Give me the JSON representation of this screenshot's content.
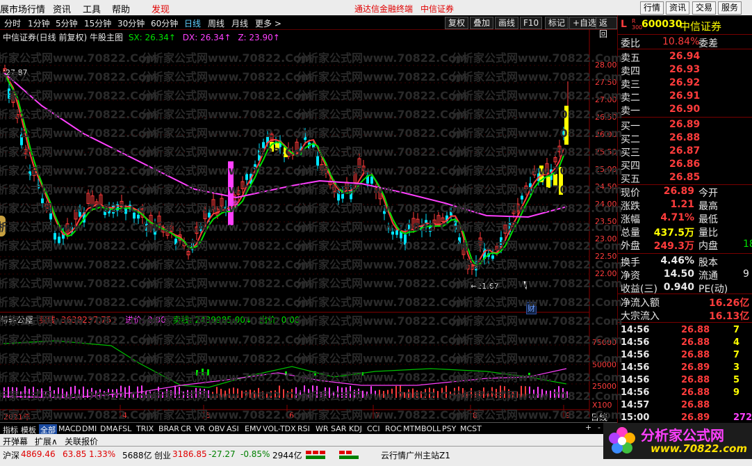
{
  "menubar": {
    "items": [
      "展市场行情",
      "资讯",
      "工具",
      "帮助",
      "发现"
    ],
    "center_links": [
      "通达信金融终端",
      "中信证券"
    ],
    "right_buttons": [
      "行情",
      "资讯",
      "交易",
      "服务"
    ]
  },
  "period_toolbar": {
    "periods": [
      "分时",
      "1分钟",
      "5分钟",
      "15分钟",
      "30分钟",
      "60分钟",
      "日线",
      "周线",
      "月线",
      "更多 >"
    ],
    "active": "日线",
    "tools": [
      "复权",
      "叠加",
      "画线",
      "F10",
      "标记",
      "+自选",
      "返回"
    ]
  },
  "chart_header": {
    "title": "中信证券(日线 前复权) 牛股主图",
    "sx": "SX: 26.34↑",
    "dx": "DX: 26.34↑",
    "z": "Z: 23.90↑"
  },
  "price_axis": [
    "28.00",
    "27.50",
    "27.00",
    "26.50",
    "26.00",
    "25.50",
    "25.00",
    "24.50",
    "24.00",
    "23.50",
    "23.00",
    "22.50",
    "22.00"
  ],
  "annotations": {
    "high": "27.87",
    "low": "←21.67",
    "ting": "停",
    "cai": "财"
  },
  "sub_header": {
    "name": "与转公屋",
    "buy_label": "买线: 3638237.75↑",
    "in_label": "进价: 0.00",
    "sell_label": "卖线: 2439985.00↓",
    "out_label": "出价: 0.00"
  },
  "sub_axis": [
    "75000",
    "50000",
    "25000",
    "X100"
  ],
  "x_axis": [
    "2021年",
    "4",
    "5",
    "6",
    "7",
    "8",
    "9"
  ],
  "x_axis_right": "日线",
  "indicator_tabs": [
    "指标",
    "模板",
    "全部",
    "MACD",
    "DMI",
    "DMA",
    "FSL",
    "TRIX",
    "BRAR",
    "CR",
    "VR",
    "OBV",
    "ASI",
    "EMV",
    "VOL-TDX",
    "RSI",
    "WR",
    "SAR",
    "KDJ",
    "CCI",
    "ROC",
    "MTM",
    "BOLL",
    "PSY",
    "MCST"
  ],
  "active_tab": "全部",
  "bottom_links": [
    "开弹幕",
    "扩展∧",
    "关联报价"
  ],
  "quote": {
    "badge_l": "L",
    "badge_r": "R 300",
    "code": "600030",
    "name": "中信证券",
    "weibi_label": "委比",
    "weibi": "10.84%",
    "weicha_label": "委差",
    "asks": [
      {
        "label": "卖五",
        "price": "26.94"
      },
      {
        "label": "卖四",
        "price": "26.93"
      },
      {
        "label": "卖三",
        "price": "26.92"
      },
      {
        "label": "卖二",
        "price": "26.91"
      },
      {
        "label": "卖一",
        "price": "26.90"
      }
    ],
    "bids": [
      {
        "label": "买一",
        "price": "26.89"
      },
      {
        "label": "买二",
        "price": "26.88"
      },
      {
        "label": "买三",
        "price": "26.87"
      },
      {
        "label": "买四",
        "price": "26.86"
      },
      {
        "label": "买五",
        "price": "26.85"
      }
    ],
    "stats": [
      {
        "label": "现价",
        "value": "26.89",
        "label2": "今开"
      },
      {
        "label": "涨跌",
        "value": "1.21",
        "label2": "最高"
      },
      {
        "label": "涨幅",
        "value": "4.71%",
        "label2": "最低"
      },
      {
        "label": "总量",
        "value": "437.5万",
        "label2": "量比"
      },
      {
        "label": "外盘",
        "value": "249.3万",
        "label2": "内盘",
        "extra": "18"
      }
    ],
    "stats2": [
      {
        "label": "换手",
        "value": "4.46%",
        "label2": "股本"
      },
      {
        "label": "净资",
        "value": "14.50",
        "label2": "流通",
        "extra": "9"
      },
      {
        "label": "收益(三)",
        "value": "0.940",
        "label2": "PE(动)"
      }
    ],
    "flows": [
      {
        "label": "净流入额",
        "value": "16.26亿"
      },
      {
        "label": "大宗流入",
        "value": "16.13亿"
      }
    ],
    "ticks": [
      {
        "time": "14:56",
        "price": "26.88",
        "vol": "7"
      },
      {
        "time": "14:56",
        "price": "26.88",
        "vol": "4"
      },
      {
        "time": "14:56",
        "price": "26.88",
        "vol": "7"
      },
      {
        "time": "14:56",
        "price": "26.89",
        "vol": "3"
      },
      {
        "time": "14:56",
        "price": "26.88",
        "vol": "5"
      },
      {
        "time": "14:56",
        "price": "26.88",
        "vol": "9"
      },
      {
        "time": "14:57",
        "price": "26.88",
        "vol": ""
      },
      {
        "time": "15:00",
        "price": "26.89",
        "vol": "272"
      }
    ]
  },
  "status_bar": {
    "sh_label": "沪深",
    "sh_value": "4869.46",
    "sh_change": "63.85",
    "sh_pct": "1.33%",
    "sh_amount": "5688亿",
    "cy_label": "创业",
    "cy_value": "3186.85",
    "cy_change": "-27.27",
    "cy_pct": "-0.85%",
    "cy_amount": "2944亿",
    "server": "云行情广州主站Z1"
  },
  "logo": {
    "text": "分析家公式网",
    "url": "www.70822.com"
  },
  "watermark": "分析家公式网www.70822.Com",
  "colors": {
    "up": "#ff3c3c",
    "down": "#00e5ff",
    "ma_white": "#ffffff",
    "ma_green": "#00e000",
    "ma_magenta": "#ff40ff",
    "yellow": "#ffff00"
  }
}
